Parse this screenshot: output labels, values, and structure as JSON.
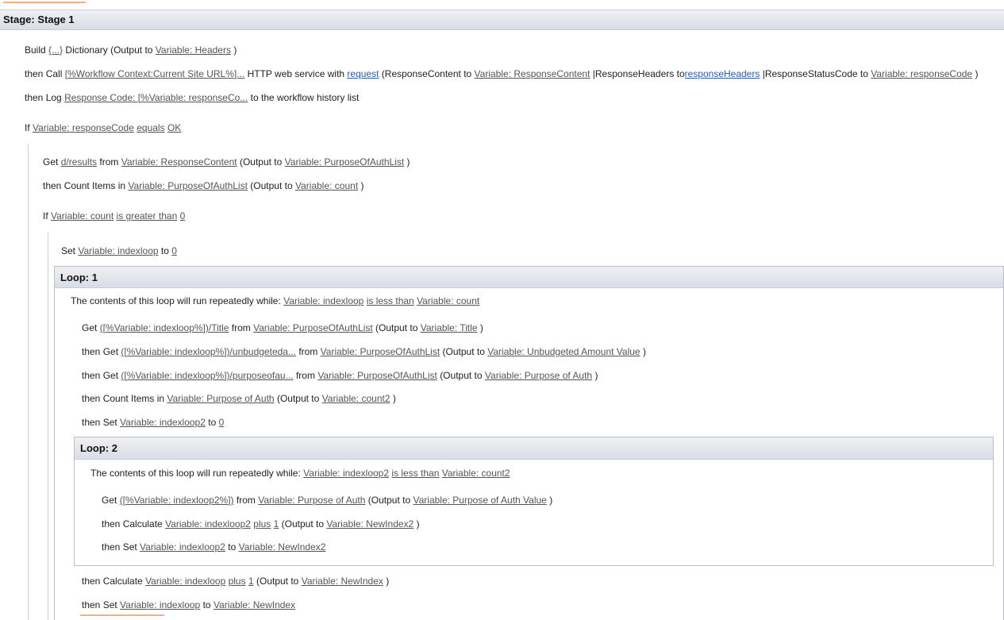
{
  "stage": {
    "title": "Stage: Stage 1"
  },
  "step1": {
    "kw": "Build",
    "dict": "{...}",
    "mid": "Dictionary (Output to",
    "var": "Variable: Headers",
    "end": ")"
  },
  "step2": {
    "kw": "then Call",
    "url": "[%Workflow Context:Current Site URL%]...",
    "svc": "HTTP web service with",
    "req": "request",
    "t1": "(ResponseContent to",
    "v1": "Variable: ResponseContent",
    "t2": "|ResponseHeaders to",
    "v2": "responseHeaders",
    "t3": "|ResponseStatusCode to",
    "v3": "Variable: responseCode",
    "end": ")"
  },
  "step3": {
    "kw": "then Log",
    "msg": "Response Code: [%Variable: responseCo...",
    "end": "to the workflow history list"
  },
  "if1": {
    "kw": "If",
    "var": "Variable: responseCode",
    "op": "equals",
    "val": "OK"
  },
  "get1": {
    "kw": "Get",
    "path": "d/results",
    "from": "from",
    "src": "Variable: ResponseContent",
    "out": "(Output to",
    "dst": "Variable: PurposeOfAuthList",
    "end": ")"
  },
  "count1": {
    "kw": "then Count Items in",
    "src": "Variable: PurposeOfAuthList",
    "out": "(Output to",
    "dst": "Variable: count",
    "end": ")"
  },
  "if2": {
    "kw": "If",
    "var": "Variable: count",
    "op": "is greater than",
    "val": "0"
  },
  "set1": {
    "kw": "Set",
    "var": "Variable: indexloop",
    "to": "to",
    "val": "0"
  },
  "loop1": {
    "title": "Loop: 1",
    "cond_text": "The contents of this loop will run repeatedly while:",
    "cond_var": "Variable: indexloop",
    "cond_op": "is less than",
    "cond_val": "Variable: count",
    "l1": {
      "kw": "Get",
      "path": "([%Variable: indexloop%])/Title",
      "from": "from",
      "src": "Variable: PurposeOfAuthList",
      "out": "(Output to",
      "dst": "Variable: Title",
      "end": ")"
    },
    "l2": {
      "kw": "then Get",
      "path": "([%Variable: indexloop%])/unbudgeteda...",
      "from": "from",
      "src": "Variable: PurposeOfAuthList",
      "out": "(Output to",
      "dst": "Variable: Unbudgeted Amount Value",
      "end": ")"
    },
    "l3": {
      "kw": "then Get",
      "path": "([%Variable: indexloop%])/purposeofau...",
      "from": "from",
      "src": "Variable: PurposeOfAuthList",
      "out": "(Output to",
      "dst": "Variable: Purpose of Auth",
      "end": ")"
    },
    "l4": {
      "kw": "then Count Items in",
      "src": "Variable: Purpose of Auth",
      "out": "(Output to",
      "dst": "Variable: count2",
      "end": ")"
    },
    "l5": {
      "kw": "then Set",
      "var": "Variable: indexloop2",
      "to": "to",
      "val": "0"
    },
    "after1": {
      "kw": "then Calculate",
      "var": "Variable: indexloop",
      "op": "plus",
      "val": "1",
      "out": "(Output to",
      "dst": "Variable: NewIndex",
      "end": ")"
    },
    "after2": {
      "kw": "then Set",
      "var": "Variable: indexloop",
      "to": "to",
      "val": "Variable: NewIndex"
    }
  },
  "loop2": {
    "title": "Loop: 2",
    "cond_text": "The contents of this loop will run repeatedly while:",
    "cond_var": "Variable: indexloop2",
    "cond_op": "is less than",
    "cond_val": "Variable: count2",
    "l1": {
      "kw": "Get",
      "path": "([%Variable: indexloop2%])",
      "from": "from",
      "src": "Variable: Purpose of Auth",
      "out": "(Output to",
      "dst": "Variable: Purpose of Auth Value",
      "end": ")"
    },
    "l2": {
      "kw": "then Calculate",
      "var": "Variable: indexloop2",
      "op": "plus",
      "val": "1",
      "out": "(Output to",
      "dst": "Variable: NewIndex2",
      "end": ")"
    },
    "l3": {
      "kw": "then Set",
      "var": "Variable: indexloop2",
      "to": "to",
      "val": "Variable: NewIndex2"
    }
  }
}
